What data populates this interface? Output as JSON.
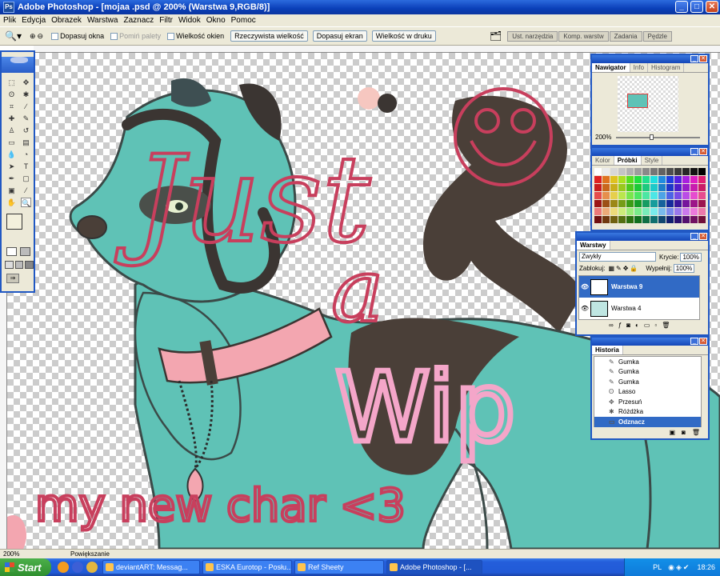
{
  "window": {
    "title": "Adobe Photoshop - [mojaa .psd @ 200% (Warstwa 9,RGB/8)]"
  },
  "menu": [
    "Plik",
    "Edycja",
    "Obrazek",
    "Warstwa",
    "Zaznacz",
    "Filtr",
    "Widok",
    "Okno",
    "Pomoc"
  ],
  "options": {
    "dopasuj_okna": "Dopasuj okna",
    "pomin_palety": "Pomiń palety",
    "wielkosc_okien": "Wielkość okien",
    "rzeczywista": "Rzeczywista wielkość",
    "dopasuj_ekran": "Dopasuj ekran",
    "druk": "Wielkość w druku"
  },
  "palette_well_tabs": [
    "Ust. narzędzia",
    "Komp. warstw",
    "Zadania",
    "Pędzle"
  ],
  "navigator": {
    "tabs": [
      "Nawigator",
      "Info",
      "Histogram"
    ],
    "zoom": "200%"
  },
  "color_panel": {
    "tabs": [
      "Kolor",
      "Próbki",
      "Style"
    ]
  },
  "layers": {
    "tab": "Warstwy",
    "blend_mode": "Zwykły",
    "opacity_label": "Krycie:",
    "opacity": "100%",
    "lock_label": "Zablokuj:",
    "fill_label": "Wypełnij:",
    "fill": "100%",
    "items": [
      {
        "name": "Warstwa 9",
        "selected": true
      },
      {
        "name": "Warstwa 4",
        "selected": false
      }
    ]
  },
  "history": {
    "tab": "Historia",
    "items": [
      {
        "label": "Gumka",
        "selected": false
      },
      {
        "label": "Gumka",
        "selected": false
      },
      {
        "label": "Gumka",
        "selected": false
      },
      {
        "label": "Lasso",
        "selected": false
      },
      {
        "label": "Przesuń",
        "selected": false
      },
      {
        "label": "Różdżka",
        "selected": false
      },
      {
        "label": "Odznacz",
        "selected": true
      }
    ]
  },
  "status": {
    "zoom": "200%",
    "text": "Powiększanie"
  },
  "taskbar": {
    "start": "Start",
    "tasks": [
      {
        "label": "deviantART: Messag...",
        "active": false
      },
      {
        "label": "ESKA Eurotop - Posłu...",
        "active": false
      },
      {
        "label": "Ref Sheety",
        "active": false
      },
      {
        "label": "Adobe Photoshop - [...",
        "active": true
      }
    ],
    "lang": "PL",
    "clock": "18:26"
  },
  "artwork": {
    "line1": "Just",
    "line2": "a",
    "line3": "Wip",
    "line4": "my new char <3"
  },
  "colors": {
    "accent": "#2158c3",
    "teal": "#5bc2b6",
    "script_red": "#c83f5d",
    "script_pink": "#f4a6c9",
    "dark_brown": "#4a3f38"
  }
}
